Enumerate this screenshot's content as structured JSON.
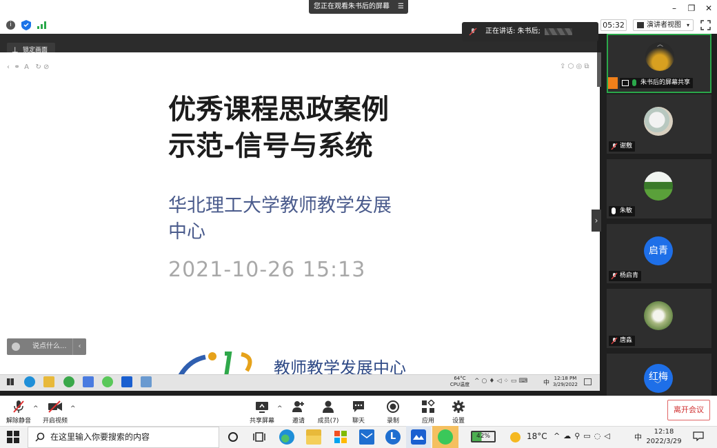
{
  "titlebar": {
    "viewing_banner": "您正在观看朱书后的屏幕",
    "minimize": "–",
    "maximize": "❐",
    "close": "✕"
  },
  "toolbar": {
    "speaking_label": "正在讲话: 朱书后;",
    "time": "05:32",
    "view_mode": "演讲者视图",
    "lock_tip": "锁定画面"
  },
  "slide": {
    "title_line1": "优秀课程思政案例",
    "title_line2": "示范-信号与系统",
    "subtitle_line1": "华北理工大学教师教学发展",
    "subtitle_line2": "中心",
    "date": "2021-10-26 15:13",
    "logo_text": "教师教学发展中心"
  },
  "chat": {
    "placeholder": "说点什么..."
  },
  "inner_taskbar": {
    "temp": "64°C",
    "cpu": "CPU温度",
    "time": "12:18 PM",
    "date": "3/29/2022",
    "ime": "中"
  },
  "participants": [
    {
      "name": "朱书后的屏幕共享",
      "initials": ""
    },
    {
      "name": "谢敷",
      "initials": ""
    },
    {
      "name": "朱敏",
      "initials": ""
    },
    {
      "name": "杨启青",
      "initials": "启青"
    },
    {
      "name": "唐淼",
      "initials": ""
    },
    {
      "name": "",
      "initials": "红梅"
    }
  ],
  "controls": {
    "unmute": "解除静音",
    "video": "开启视频",
    "share": "共享屏幕",
    "invite": "邀请",
    "members": "成员(7)",
    "chat": "聊天",
    "record": "录制",
    "apps": "应用",
    "settings": "设置",
    "leave": "离开会议"
  },
  "taskbar": {
    "search_placeholder": "在这里输入你要搜索的内容",
    "battery": "42%",
    "weather": "18°C",
    "ime": "中",
    "time": "12:18",
    "date": "2022/3/29"
  },
  "colors": {
    "accent": "#1a73e8",
    "leave": "#d03030",
    "avatar_blue": "#1e6fe8"
  }
}
